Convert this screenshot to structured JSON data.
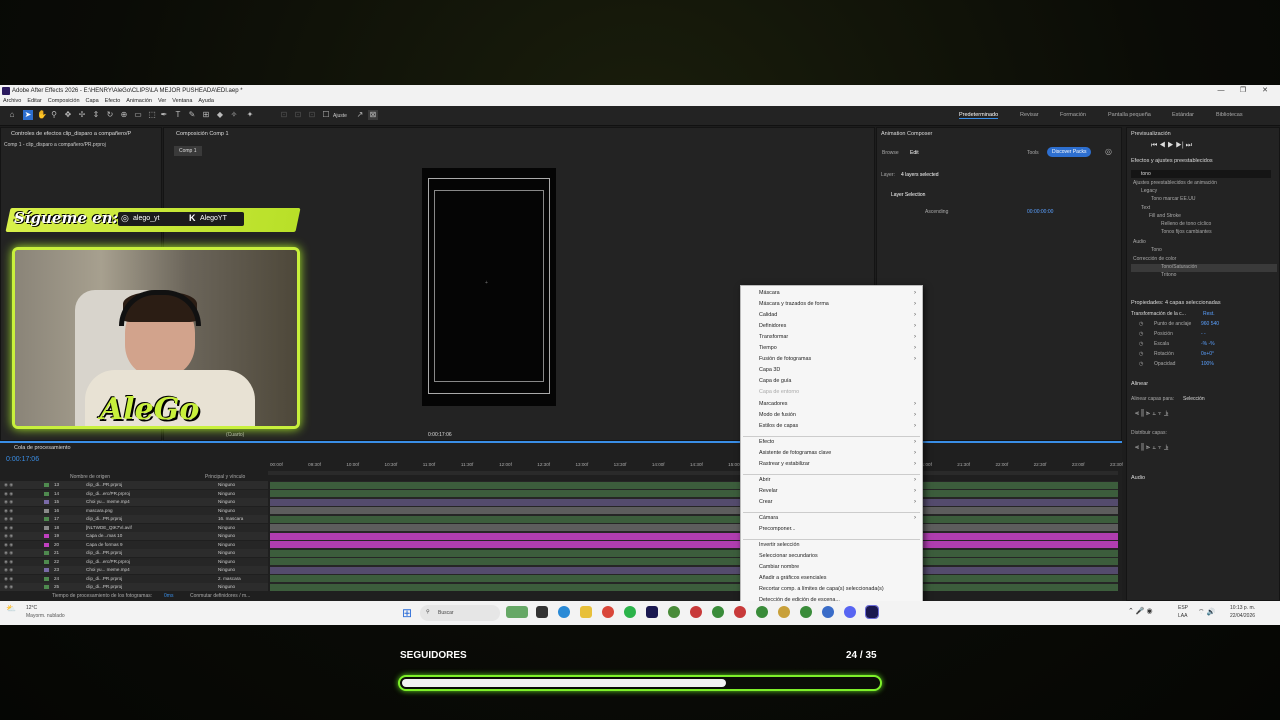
{
  "app": {
    "title": "Adobe After Effects 2026 - E:\\HENRY\\AleGo\\CLIPS\\LA MEJOR PUSHEADA\\EDI.aep *",
    "menu": [
      "Archivo",
      "Editar",
      "Composición",
      "Capa",
      "Efecto",
      "Animación",
      "Ver",
      "Ventana",
      "Ayuda"
    ],
    "align_label": "Ajuste",
    "workspaces": [
      "Predeterminado",
      "Revisar",
      "Formación",
      "Pantalla pequeña",
      "Estándar",
      "Bibliotecas"
    ]
  },
  "left_panel": {
    "tab": "Controles de efectos clip_disparo a compañero/P",
    "subtitle": "Comp 1 - clip_disparo a compañero/PR.prproj"
  },
  "comp_panel": {
    "tab": "Composición Comp 1",
    "crumb": "Comp 1",
    "zoom": "(Cuarto)",
    "timecode": "0:00:17:06"
  },
  "animation_composer": {
    "title": "Animation Composer",
    "tabs": [
      "Browse",
      "Edit"
    ],
    "tools": "Tools",
    "discover": "Discover Packs",
    "layer_label": "Layer:",
    "layer_value": "4 layers selected",
    "section": "Layer Selection",
    "order": "Ascending",
    "time": "00:00:00:00"
  },
  "context_menu": {
    "groups": [
      [
        {
          "label": "Máscara",
          "sub": true
        },
        {
          "label": "Máscara y trazados de forma",
          "sub": true
        },
        {
          "label": "Calidad",
          "sub": true
        },
        {
          "label": "Definidores",
          "sub": true
        },
        {
          "label": "Transformar",
          "sub": true
        },
        {
          "label": "Tiempo",
          "sub": true
        },
        {
          "label": "Fusión de fotogramas",
          "sub": true
        },
        {
          "label": "Capa 3D",
          "sub": false
        },
        {
          "label": "Capa de guía",
          "sub": false
        },
        {
          "label": "Capa de entorno",
          "sub": false,
          "disabled": true
        },
        {
          "label": "Marcadores",
          "sub": true
        },
        {
          "label": "Modo de fusión",
          "sub": true
        },
        {
          "label": "Estilos de capas",
          "sub": true
        }
      ],
      [
        {
          "label": "Efecto",
          "sub": true
        },
        {
          "label": "Asistente de fotogramas clave",
          "sub": true
        },
        {
          "label": "Rastrear y estabilizar",
          "sub": true
        }
      ],
      [
        {
          "label": "Abrir",
          "sub": true
        },
        {
          "label": "Revelar",
          "sub": true
        },
        {
          "label": "Crear",
          "sub": true
        }
      ],
      [
        {
          "label": "Cámara",
          "sub": true
        },
        {
          "label": "Precomponer...",
          "sub": false
        }
      ],
      [
        {
          "label": "Invertir selección",
          "sub": false
        },
        {
          "label": "Seleccionar secundarios",
          "sub": false
        },
        {
          "label": "Cambiar nombre",
          "sub": false
        },
        {
          "label": "Añadir a gráficos esenciales",
          "sub": false
        },
        {
          "label": "Recortar comp. a límites de capa(s) seleccionada(s)",
          "sub": false
        },
        {
          "label": "Detección de edición de escena...",
          "sub": false
        }
      ]
    ]
  },
  "preview": {
    "title": "Previsualización"
  },
  "effects": {
    "title": "Efectos y ajustes preestablecidos",
    "search": "tono",
    "tree": [
      "Ajustes preestablecidos de animación",
      "Legacy",
      "Tono marcar EE.UU",
      "Text",
      "Fill and Stroke",
      "Relleno de tono cíclico",
      "Tonos fijos cambiantes",
      "Audio",
      "Tono",
      "Corrección de color",
      "Tono/Saturación",
      "Tritono"
    ]
  },
  "properties": {
    "title": "Propiedades: 4 capas seleccionadas",
    "transform": "Transformación de la c...",
    "reset": "Rest.",
    "rows": [
      {
        "label": "Punto de anclaje",
        "value": "960    540"
      },
      {
        "label": "Posición",
        "value": "-    -"
      },
      {
        "label": "Escala",
        "value": "-%    -%"
      },
      {
        "label": "Rotación",
        "value": "0x+0°"
      },
      {
        "label": "Opacidad",
        "value": "100%"
      }
    ]
  },
  "align": {
    "title": "Alinear",
    "align_to": "Alinear capas para:",
    "selection": "Selección",
    "distribute": "Distribuir capas:"
  },
  "audio": {
    "title": "Audio"
  },
  "timeline": {
    "tab": "Cola de procesamiento",
    "comp_tab": "Comp 1",
    "timecode": "0:00:17:06",
    "col_name": "Nombre de origen",
    "col_parent": "Principal y vínculo",
    "ruler": [
      "00:00f",
      "09:30f",
      "10:00f",
      "10:30f",
      "11:00f",
      "11:30f",
      "12:00f",
      "12:30f",
      "13:00f",
      "13:30f",
      "14:00f",
      "14:30f",
      "15:00f",
      "15:30f",
      "16:00f",
      "16:30f",
      "20:30f",
      "21:00f",
      "21:30f",
      "22:00f",
      "22:30f",
      "23:00f",
      "23:30f"
    ],
    "layers": [
      {
        "num": "13",
        "name": "clip_di...PR.prproj",
        "parent": "Ninguno",
        "color": "#4f8a4f"
      },
      {
        "num": "14",
        "name": "clip_di...erc/PR.prproj",
        "parent": "Ninguno",
        "color": "#4f8a4f"
      },
      {
        "num": "15",
        "name": "Choi yu... meme.mp4",
        "parent": "Ninguno",
        "color": "#7a6aa8"
      },
      {
        "num": "16",
        "name": "mascara.png",
        "parent": "Ninguno",
        "color": "#8a8a8a"
      },
      {
        "num": "17",
        "name": "clip_di...PR.prproj",
        "parent": "16. mascara",
        "color": "#4f8a4f"
      },
      {
        "num": "18",
        "name": "[NLTWDE_QtK7Vi.avif",
        "parent": "Ninguno",
        "color": "#8a8a8a"
      },
      {
        "num": "19",
        "name": "Capa de...mas 10",
        "parent": "Ninguno",
        "color": "#c040c0"
      },
      {
        "num": "20",
        "name": "Capa de formas 9",
        "parent": "Ninguno",
        "color": "#c040c0"
      },
      {
        "num": "21",
        "name": "clip_di...PR.prproj",
        "parent": "Ninguno",
        "color": "#4f8a4f"
      },
      {
        "num": "22",
        "name": "clip_di...erc/PR.prproj",
        "parent": "Ninguno",
        "color": "#4f8a4f"
      },
      {
        "num": "23",
        "name": "Choi yu... meme.mp4",
        "parent": "Ninguno",
        "color": "#7a6aa8"
      },
      {
        "num": "24",
        "name": "clip_di...PR.prproj",
        "parent": "2. mascara",
        "color": "#4f8a4f"
      },
      {
        "num": "25",
        "name": "clip_di...PR.prproj",
        "parent": "Ninguno",
        "color": "#4f8a4f"
      }
    ],
    "footer_left": "Tiempo de procesamiento de los fotogramas:",
    "footer_ms": "0ms",
    "footer_right": "Conmutar definidores / m..."
  },
  "taskbar": {
    "weather_temp": "12°C",
    "weather_desc": "Mayorm. nublado",
    "search": "Buscar",
    "lang": "ESP",
    "region": "LAA",
    "time": "10:13 p. m.",
    "date": "22/04/2026"
  },
  "overlay": {
    "banner_text": "Sígueme en:",
    "handle_1": "alego_yt",
    "handle_2": "AlegoYT",
    "logo": "AleGo",
    "followers_label": "SEGUIDORES",
    "followers_count": "24 / 35",
    "progress": 0.68,
    "accent": "#7ef02a"
  }
}
